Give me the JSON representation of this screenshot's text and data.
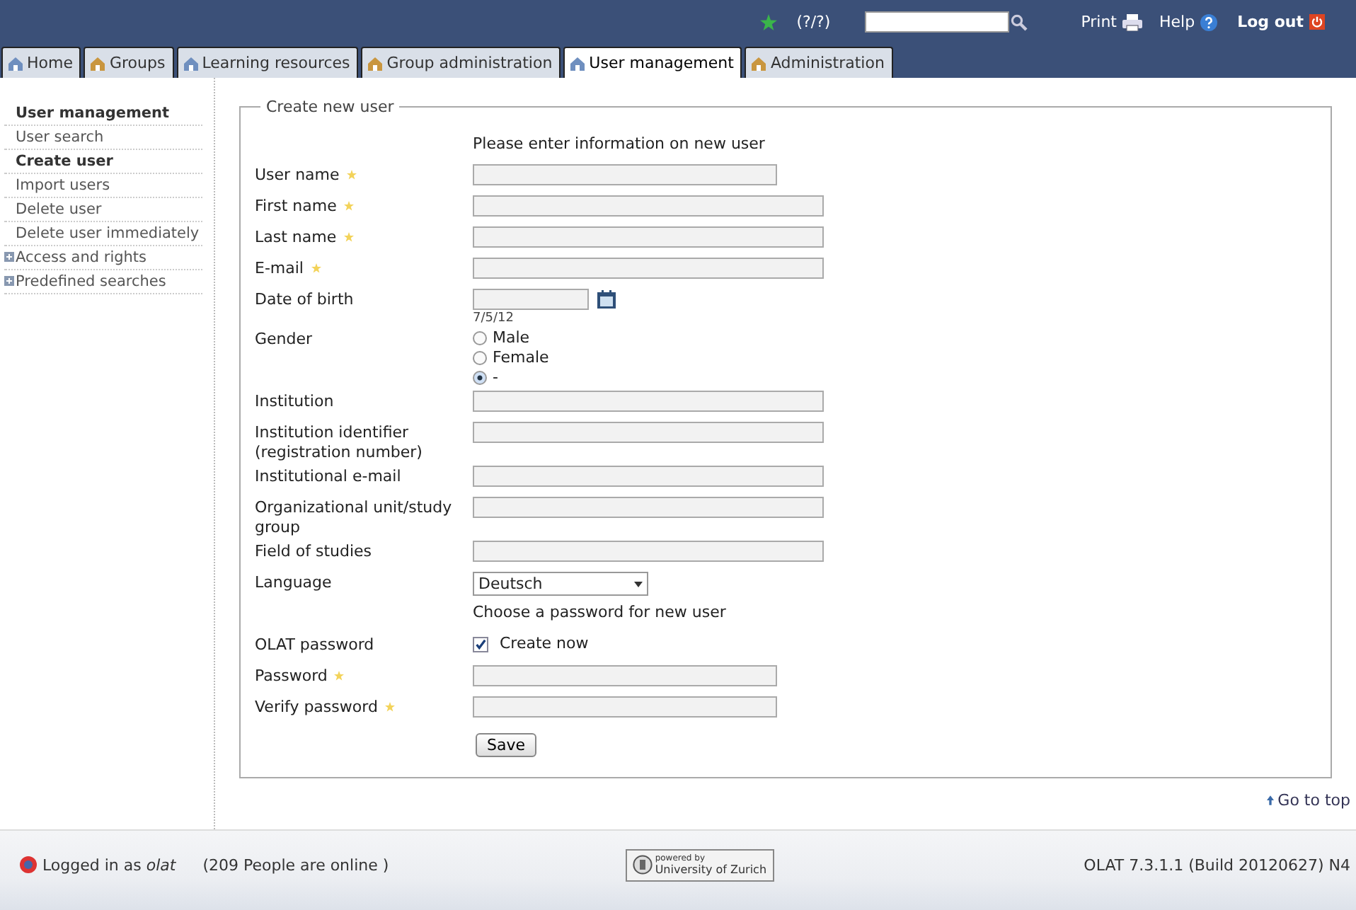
{
  "header": {
    "status": "(?/?)",
    "links": [
      {
        "label": "Print"
      },
      {
        "label": "Help"
      },
      {
        "label": "Log out"
      }
    ]
  },
  "tabs": [
    {
      "label": "Home",
      "selected": false
    },
    {
      "label": "Groups",
      "selected": false
    },
    {
      "label": "Learning resources",
      "selected": false
    },
    {
      "label": "Group administration",
      "selected": false
    },
    {
      "label": "User management",
      "selected": true
    },
    {
      "label": "Administration",
      "selected": false
    }
  ],
  "sidebar": {
    "title": "User management",
    "items": [
      {
        "label": "User search",
        "selected": false,
        "expandable": false
      },
      {
        "label": "Create user",
        "selected": true,
        "expandable": false
      },
      {
        "label": "Import users",
        "selected": false,
        "expandable": false
      },
      {
        "label": "Delete user",
        "selected": false,
        "expandable": false
      },
      {
        "label": "Delete user immediately",
        "selected": false,
        "expandable": false
      },
      {
        "label": "Access and rights",
        "selected": false,
        "expandable": true
      },
      {
        "label": "Predefined searches",
        "selected": false,
        "expandable": true
      }
    ]
  },
  "form": {
    "legend": "Create new user",
    "intro": "Please enter information on new user",
    "fields": [
      {
        "kind": "text",
        "label": "User name",
        "required": true,
        "wide": false
      },
      {
        "kind": "text",
        "label": "First name",
        "required": true,
        "wide": true
      },
      {
        "kind": "text",
        "label": "Last name",
        "required": true,
        "wide": true
      },
      {
        "kind": "text",
        "label": "E-mail",
        "required": true,
        "wide": true
      },
      {
        "kind": "date",
        "label": "Date of birth",
        "required": false,
        "hint": "7/5/12"
      },
      {
        "kind": "radio",
        "label": "Gender",
        "required": false,
        "options": [
          {
            "label": "Male",
            "selected": false
          },
          {
            "label": "Female",
            "selected": false
          },
          {
            "label": "-",
            "selected": true
          }
        ]
      },
      {
        "kind": "text",
        "label": "Institution",
        "required": false,
        "wide": true
      },
      {
        "kind": "text",
        "label": "Institution identifier (registration number)",
        "required": false,
        "wide": true
      },
      {
        "kind": "text",
        "label": "Institutional e-mail",
        "required": false,
        "wide": true
      },
      {
        "kind": "text",
        "label": "Organizational unit/study group",
        "required": false,
        "wide": true
      },
      {
        "kind": "text",
        "label": "Field of studies",
        "required": false,
        "wide": true
      },
      {
        "kind": "select",
        "label": "Language",
        "required": false,
        "value": "Deutsch"
      },
      {
        "kind": "heading",
        "text": "Choose a password for new user"
      },
      {
        "kind": "checkbox",
        "label": "OLAT password",
        "required": false,
        "option": "Create now",
        "checked": true
      },
      {
        "kind": "text",
        "label": "Password",
        "required": true,
        "wide": false
      },
      {
        "kind": "text",
        "label": "Verify password",
        "required": true,
        "wide": false
      }
    ],
    "button": "Save"
  },
  "go_to_top": "Go to top",
  "footer": {
    "logged_in": "Logged in as *olat*",
    "online": "(209 People are online )",
    "badge_top": "powered by",
    "badge_bottom": "University of Zurich",
    "version": "OLAT 7.3.1.1 (Build 20120627) N4"
  }
}
